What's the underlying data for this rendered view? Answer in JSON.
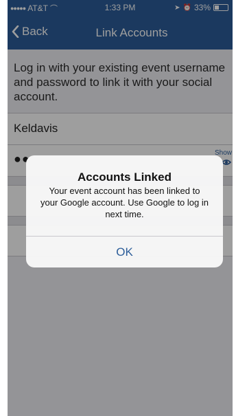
{
  "status_bar": {
    "carrier_dots": "●●●●●",
    "carrier": "AT&T",
    "wifi_glyph": "⌒",
    "time": "1:33 PM",
    "location_glyph": "➤",
    "alarm_glyph": "⏰",
    "battery": "33%",
    "battery_level": 0.33
  },
  "nav": {
    "back_label": "Back",
    "title": "Link Accounts"
  },
  "form": {
    "intro": "Log in with your existing event username and password to link it with your social account.",
    "username_value": "Keldavis",
    "password_masked": "●●",
    "show_label": "Show"
  },
  "alert": {
    "title": "Accounts Linked",
    "message": "Your event account has been linked to your Google account. Use Google to log in next time.",
    "ok_label": "OK"
  },
  "colors": {
    "nav_bar": "#2c5d99",
    "accent": "#2c5d99",
    "background": "#efeff4"
  },
  "icons": [
    "chevron-left-icon",
    "wifi-icon",
    "location-icon",
    "alarm-icon",
    "battery-icon",
    "eye-icon"
  ]
}
